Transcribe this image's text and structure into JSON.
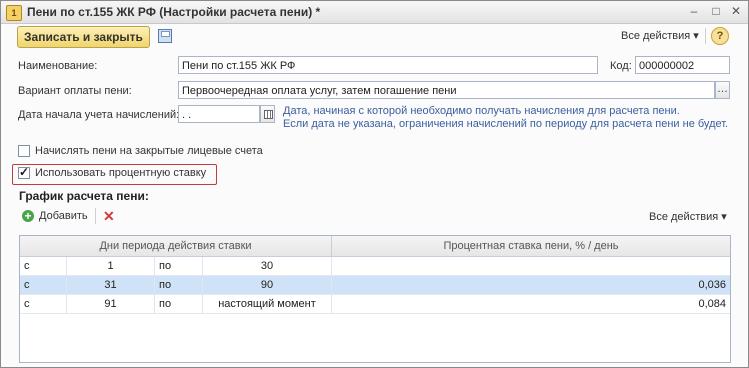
{
  "window": {
    "title": "Пени по ст.155 ЖК РФ (Настройки расчета пени) *"
  },
  "toolbar": {
    "save_close_label": "Записать и закрыть",
    "all_actions_label": "Все действия ▾",
    "help_label": "?"
  },
  "form": {
    "name_label": "Наименование:",
    "name_value": "Пени по ст.155 ЖК РФ",
    "code_label": "Код:",
    "code_value": "000000002",
    "variant_label": "Вариант оплаты пени:",
    "variant_value": "Первоочередная оплата услуг, затем погашение пени",
    "date_label": "Дата начала учета начислений:",
    "date_value": " .  .",
    "hint_line1": "Дата, начиная с которой необходимо получать начисления для расчета пени.",
    "hint_line2": "Если дата не указана, ограничения начислений по периоду для расчета пени не будет.",
    "closed_accounts_label": "Начислять пени на закрытые лицевые счета",
    "closed_accounts_checked": false,
    "use_rate_label": "Использовать процентную ставку",
    "use_rate_checked": true
  },
  "schedule": {
    "title": "График расчета пени:",
    "add_label": "Добавить",
    "all_actions_label": "Все действия ▾",
    "columns": [
      "Дни периода действия ставки",
      "Процентная ставка пени, % / день"
    ],
    "rows": [
      {
        "from_word": "с",
        "from": "1",
        "to_word": "по",
        "to": "30",
        "rate": ""
      },
      {
        "from_word": "с",
        "from": "31",
        "to_word": "по",
        "to": "90",
        "rate": "0,036"
      },
      {
        "from_word": "с",
        "from": "91",
        "to_word": "по",
        "to": "настоящий момент",
        "rate": "0,084"
      }
    ]
  },
  "colors": {
    "selected_row": "#cfe2f7",
    "highlight_border": "#c43b3b",
    "hint_text": "#3b5fa0"
  }
}
